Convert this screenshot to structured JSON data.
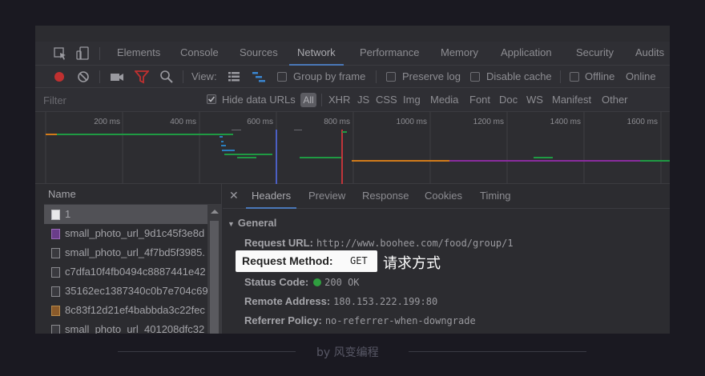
{
  "devtools": {
    "tabs": [
      "Elements",
      "Console",
      "Sources",
      "Network",
      "Performance",
      "Memory",
      "Application",
      "Security",
      "Audits"
    ],
    "active_tab": "Network",
    "controls": {
      "view_label": "View:",
      "group_by_frame": "Group by frame",
      "preserve_log": "Preserve log",
      "disable_cache": "Disable cache",
      "offline": "Offline",
      "online": "Online"
    },
    "filter": {
      "placeholder": "Filter",
      "hide_data_urls": "Hide data URLs",
      "all": "All",
      "types": [
        "XHR",
        "JS",
        "CSS",
        "Img",
        "Media",
        "Font",
        "Doc",
        "WS",
        "Manifest",
        "Other"
      ]
    },
    "timeline": {
      "ticks": [
        "200 ms",
        "400 ms",
        "600 ms",
        "800 ms",
        "1000 ms",
        "1200 ms",
        "1400 ms",
        "1600 ms"
      ],
      "colors": {
        "doc": "#2a7fbf",
        "green": "#1f9a43",
        "orange": "#d27b1a",
        "purple": "#8a2c9e",
        "blue_line": "#4b5fc4",
        "red_line": "#c0353a"
      }
    },
    "requests": {
      "header": "Name",
      "rows": [
        "1",
        "small_photo_url_9d1c45f3e8d",
        "small_photo_url_4f7bd5f3985.",
        "c7dfa10f4fb0494c8887441e42",
        "35162ec1387340c0b7e704c69",
        "8c83f12d21ef4babbda3c22fec",
        "small_photo_url_401208dfc32"
      ]
    },
    "details": {
      "tabs": [
        "Headers",
        "Preview",
        "Response",
        "Cookies",
        "Timing"
      ],
      "active_tab": "Headers",
      "section": "General",
      "request_url_key": "Request URL:",
      "request_url": "http://www.boohee.com/food/group/1",
      "request_method_key": "Request Method:",
      "request_method": "GET",
      "status_code_key": "Status Code:",
      "status_code": "200 OK",
      "remote_address_key": "Remote Address:",
      "remote_address": "180.153.222.199:80",
      "referrer_policy_key": "Referrer Policy:",
      "referrer_policy": "no-referrer-when-downgrade"
    }
  },
  "annotation": "请求方式",
  "footer": "by 风变编程"
}
